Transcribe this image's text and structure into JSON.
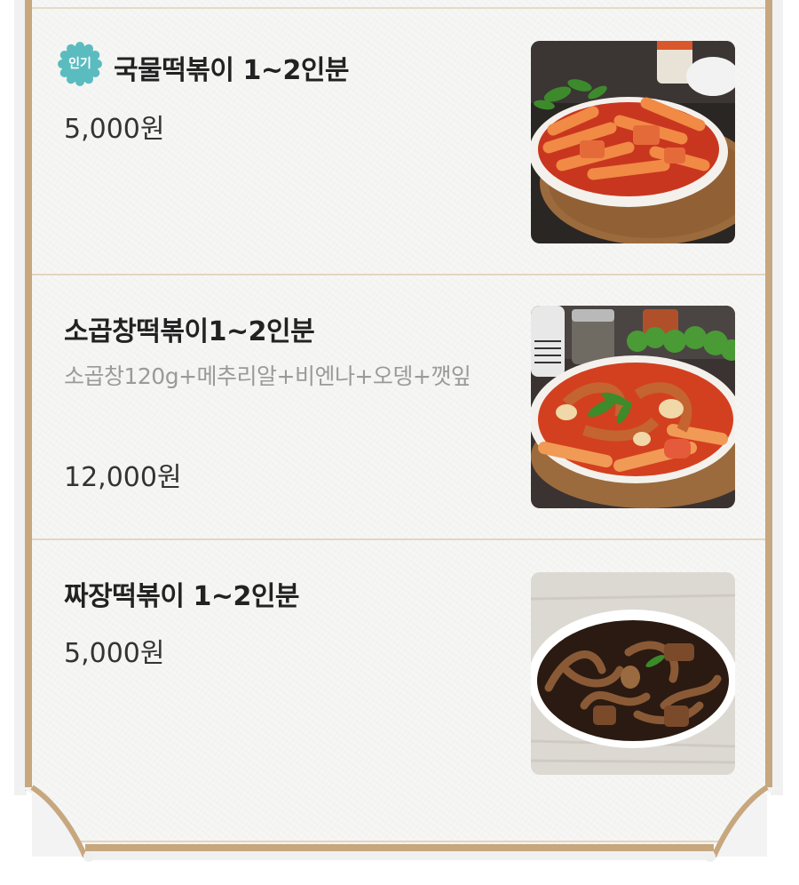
{
  "menu": {
    "items": [
      {
        "name": "국물떡볶이 1~2인분",
        "badge": "인기",
        "description": "",
        "price": "5,000원",
        "image_icon": "soup-tteokbokki-photo"
      },
      {
        "name": "소곱창떡볶이1~2인분",
        "badge": "",
        "description": "소곱창120g+메추리알+비엔나+오뎅+깻잎",
        "price": "12,000원",
        "image_icon": "gopchang-tteokbokki-photo"
      },
      {
        "name": "짜장떡볶이 1~2인분",
        "badge": "",
        "description": "",
        "price": "5,000원",
        "image_icon": "jjajang-tteokbokki-photo"
      }
    ]
  },
  "colors": {
    "badge": "#5bbcc0",
    "rail": "#c7a77e",
    "divider": "#e4d5c0",
    "paper": "#f6f6f5"
  }
}
